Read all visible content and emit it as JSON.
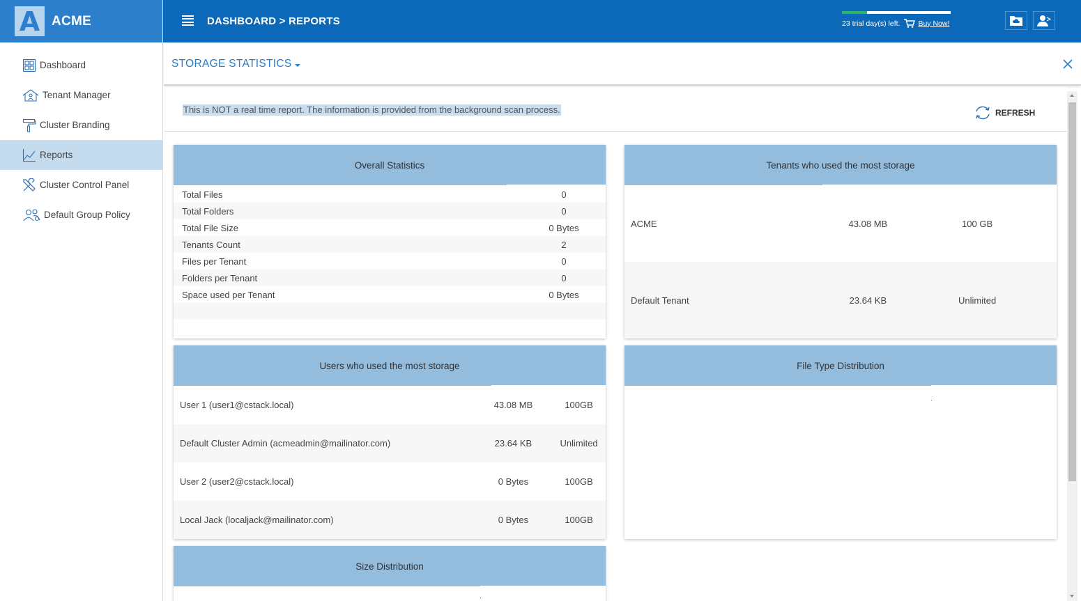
{
  "brand": {
    "logo_letter": "A",
    "name": "ACME"
  },
  "sidebar": {
    "items": [
      {
        "label": "Dashboard",
        "icon": "dashboard-icon",
        "active": false
      },
      {
        "label": "Tenant Manager",
        "icon": "tenant-house-icon",
        "active": false
      },
      {
        "label": "Cluster Branding",
        "icon": "paint-roller-icon",
        "active": false
      },
      {
        "label": "Reports",
        "icon": "chart-line-icon",
        "active": true
      },
      {
        "label": "Cluster Control Panel",
        "icon": "tools-icon",
        "active": false
      },
      {
        "label": "Default Group Policy",
        "icon": "users-group-icon",
        "active": false
      }
    ]
  },
  "header": {
    "breadcrumb": "DASHBOARD > REPORTS",
    "trial_text": "23 trial day(s) left.",
    "buy_now": "Buy Now!",
    "trial_progress": 0.23,
    "buttons": [
      {
        "icon": "cloud-folder-icon"
      },
      {
        "icon": "user-account-icon"
      }
    ]
  },
  "subheader": {
    "report_selector": "STORAGE STATISTICS"
  },
  "notice": "This is NOT a real time report. The information is provided from the background scan process.",
  "refresh_label": "REFRESH",
  "overall": {
    "title": "Overall Statistics",
    "rows": [
      {
        "label": "Total Files",
        "value": "0"
      },
      {
        "label": "Total Folders",
        "value": "0"
      },
      {
        "label": "Total File Size",
        "value": "0 Bytes"
      },
      {
        "label": "Tenants Count",
        "value": "2"
      },
      {
        "label": "Files per Tenant",
        "value": "0"
      },
      {
        "label": "Folders per Tenant",
        "value": "0"
      },
      {
        "label": "Space used per Tenant",
        "value": "0 Bytes"
      }
    ]
  },
  "tenants": {
    "title": "Tenants who used the most storage",
    "rows": [
      {
        "name": "ACME",
        "used": "43.08 MB",
        "quota": "100 GB"
      },
      {
        "name": "Default Tenant",
        "used": "23.64 KB",
        "quota": "Unlimited"
      }
    ]
  },
  "users": {
    "title": "Users who used the most storage",
    "rows": [
      {
        "name": "User 1 (user1@cstack.local)",
        "used": "43.08 MB",
        "quota": "100GB"
      },
      {
        "name": "Default Cluster Admin (acmeadmin@mailinator.com)",
        "used": "23.64 KB",
        "quota": "Unlimited"
      },
      {
        "name": "User 2 (user2@cstack.local)",
        "used": "0 Bytes",
        "quota": "100GB"
      },
      {
        "name": "Local Jack (localjack@mailinator.com)",
        "used": "0 Bytes",
        "quota": "100GB"
      }
    ]
  },
  "file_types": {
    "title": "File Type Distribution"
  },
  "size_distribution": {
    "title": "Size Distribution"
  }
}
